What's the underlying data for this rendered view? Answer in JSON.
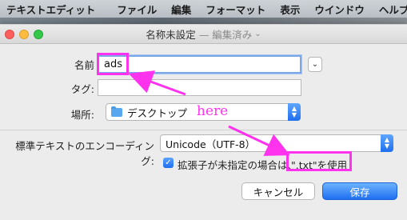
{
  "menubar": {
    "app_name": "テキストエディット",
    "items": [
      "ファイル",
      "編集",
      "フォーマット",
      "表示",
      "ウインドウ",
      "ヘルプ"
    ]
  },
  "dialog": {
    "title": "名称未設定",
    "subtitle": "— 編集済み",
    "name_label": "名前",
    "name_value": "ads",
    "tags_label": "タグ:",
    "tags_value": "",
    "location_label": "場所:",
    "location_value": "デスクトップ",
    "encoding_label": "標準テキストのエンコーディング:",
    "encoding_value": "Unicode（UTF-8）",
    "checkbox_label": "拡張子が未指定の場合は、",
    "checkbox_suffix": "\".txt\"を使用",
    "checkbox_checked": true,
    "cancel_label": "キャンセル",
    "save_label": "保存"
  },
  "annotation": {
    "note": "here",
    "color": "#ff33ee"
  },
  "colors": {
    "accent": "#1f6ff0",
    "highlight": "#ff33ee"
  }
}
